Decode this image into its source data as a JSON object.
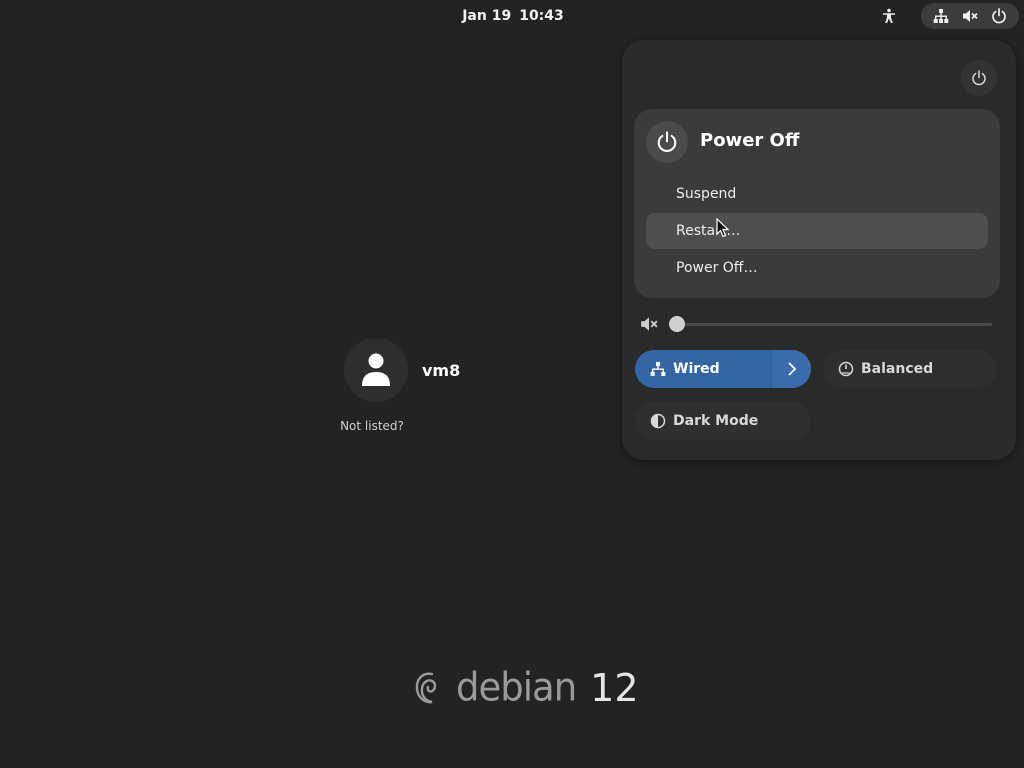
{
  "topbar": {
    "date": "Jan 19",
    "time": "10:43",
    "icons": [
      "accessibility-icon",
      "network-wired-icon",
      "volume-muted-icon",
      "power-icon"
    ]
  },
  "login": {
    "username": "vm8",
    "not_listed": "Not listed?"
  },
  "logo": {
    "word": "debian",
    "version": "12"
  },
  "quick_settings": {
    "power_menu": {
      "title": "Power Off",
      "items": [
        {
          "label": "Suspend",
          "hovered": false
        },
        {
          "label": "Restart…",
          "hovered": true
        },
        {
          "label": "Power Off…",
          "hovered": false
        }
      ]
    },
    "volume": {
      "muted": true,
      "level": 0
    },
    "toggles": [
      {
        "label": "Wired",
        "active": true,
        "icon": "network-wired-icon",
        "has_arrow": true
      },
      {
        "label": "Balanced",
        "active": false,
        "icon": "power-profile-icon"
      },
      {
        "label": "Dark Mode",
        "active": false,
        "icon": "dark-mode-icon"
      }
    ]
  },
  "colors": {
    "background": "#232323",
    "panel": "#2a2a2a",
    "submenu": "#3b3b3b",
    "accent": "#3465a4"
  }
}
